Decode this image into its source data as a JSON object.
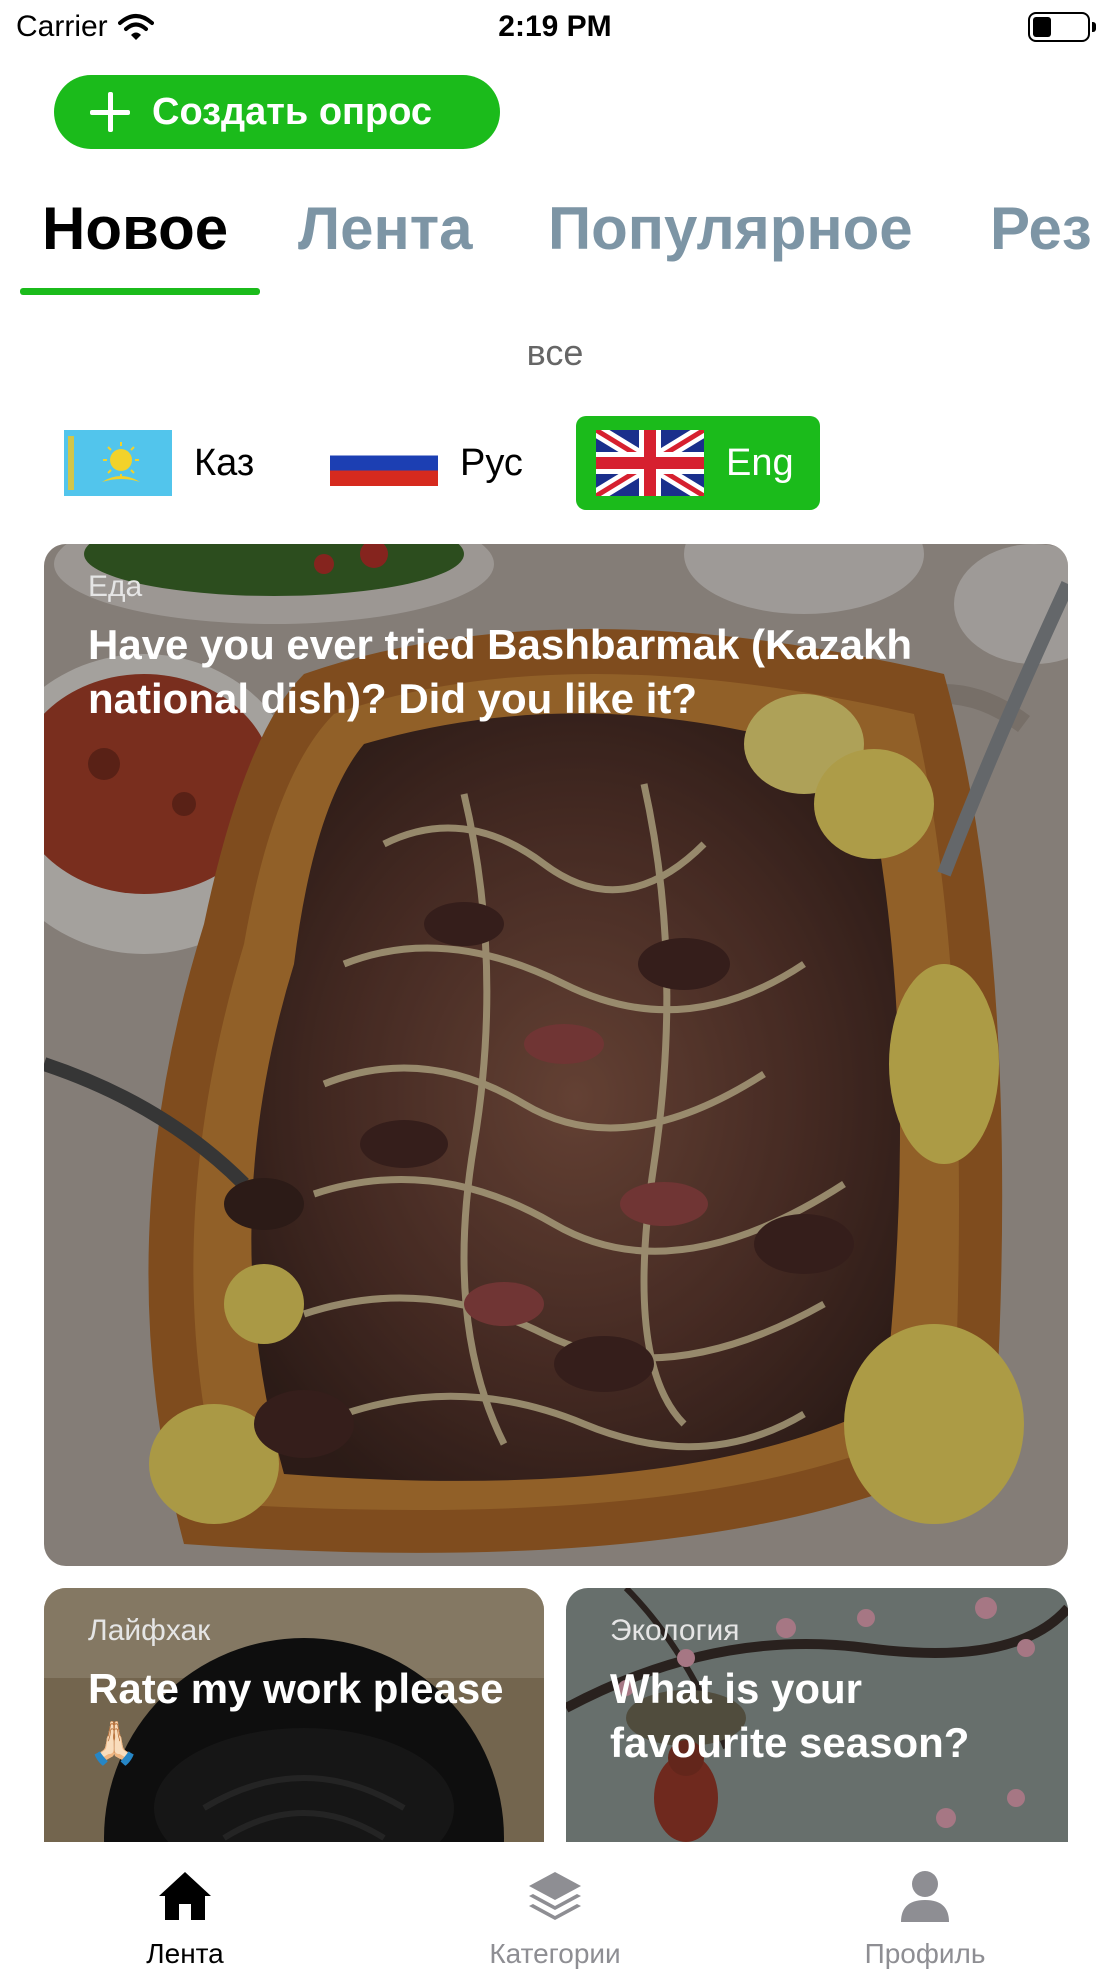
{
  "status_bar": {
    "carrier": "Carrier",
    "time": "2:19 PM"
  },
  "create_button": {
    "label": "Создать опрос"
  },
  "tabs": [
    {
      "label": "Новое",
      "active": true
    },
    {
      "label": "Лента",
      "active": false
    },
    {
      "label": "Популярное",
      "active": false
    },
    {
      "label": "Рез",
      "active": false
    }
  ],
  "filter": {
    "label": "все"
  },
  "languages": [
    {
      "label": "Каз",
      "active": false
    },
    {
      "label": "Рус",
      "active": false
    },
    {
      "label": "Eng",
      "active": true
    }
  ],
  "cards": [
    {
      "category": "Еда",
      "title": "Have you ever tried Bashbarmak (Kazakh national dish)? Did you like it?"
    },
    {
      "category": "Лайфхак",
      "title": "Rate my work please 🙏🏻"
    },
    {
      "category": "Экология",
      "title": "What is your favourite season?"
    }
  ],
  "tabbar": [
    {
      "label": "Лента",
      "icon": "home-icon",
      "active": true
    },
    {
      "label": "Категории",
      "icon": "layers-icon",
      "active": false
    },
    {
      "label": "Профиль",
      "icon": "profile-icon",
      "active": false
    }
  ],
  "colors": {
    "accent": "#1bbb1b",
    "inactive_tab": "#7d95a5"
  }
}
